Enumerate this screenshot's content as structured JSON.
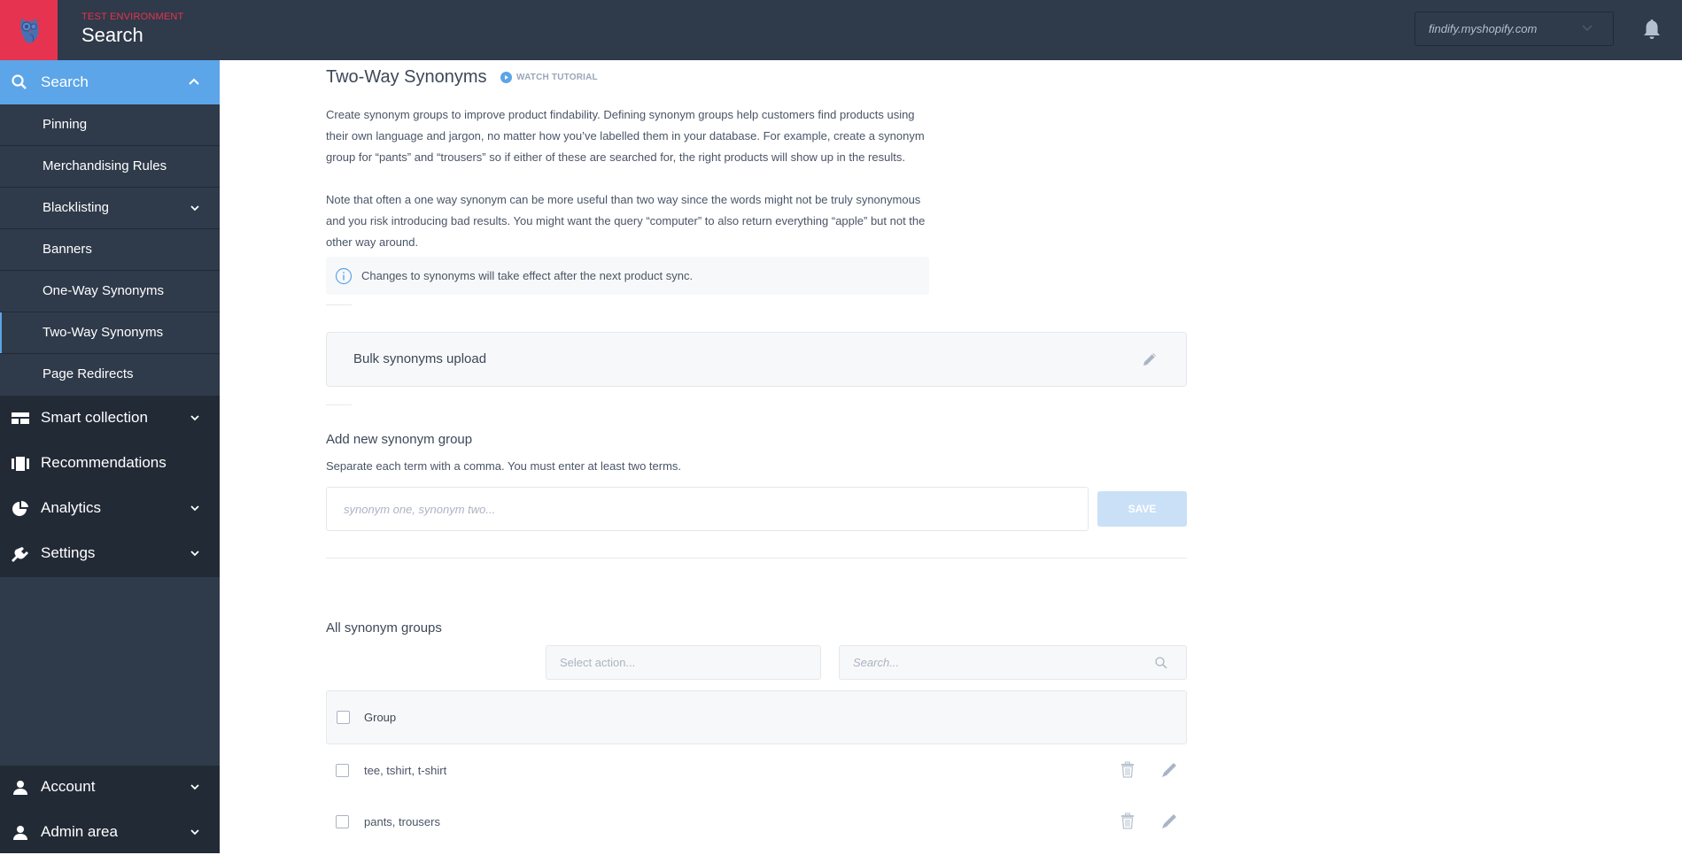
{
  "header": {
    "environment_label": "TEST ENVIRONMENT",
    "title": "Search",
    "shop_selector": {
      "value": "findify.myshopify.com"
    },
    "notifications_icon": "bell-icon"
  },
  "colors": {
    "brand_red": "#e63350",
    "accent_blue": "#5ba5e8",
    "header_bg": "#2f3a4a",
    "sidebar_dark": "#222a36"
  },
  "sidebar": {
    "search": {
      "label": "Search",
      "icon": "search-icon",
      "expanded": true
    },
    "sub_items": [
      {
        "label": "Pinning",
        "has_children": false,
        "active": false
      },
      {
        "label": "Merchandising Rules",
        "has_children": false,
        "active": false
      },
      {
        "label": "Blacklisting",
        "has_children": true,
        "active": false
      },
      {
        "label": "Banners",
        "has_children": false,
        "active": false
      },
      {
        "label": "One-Way Synonyms",
        "has_children": false,
        "active": false
      },
      {
        "label": "Two-Way Synonyms",
        "has_children": false,
        "active": true
      },
      {
        "label": "Page Redirects",
        "has_children": false,
        "active": false
      }
    ],
    "main_items": [
      {
        "label": "Smart collection",
        "icon": "layout-icon",
        "has_children": true
      },
      {
        "label": "Recommendations",
        "icon": "carousel-icon",
        "has_children": false
      },
      {
        "label": "Analytics",
        "icon": "pie-chart-icon",
        "has_children": true
      },
      {
        "label": "Settings",
        "icon": "plug-icon",
        "has_children": true
      }
    ],
    "bottom_items": [
      {
        "label": "Account",
        "icon": "user-icon",
        "has_children": true
      },
      {
        "label": "Admin area",
        "icon": "user-icon",
        "has_children": true
      }
    ]
  },
  "main": {
    "title": "Two-Way Synonyms",
    "watch_tutorial": "WATCH TUTORIAL",
    "description_1": "Create synonym groups to improve product findability. Defining synonym groups help customers find products using their own language and jargon, no matter how you’ve labelled them in your database. For example, create a synonym group for “pants” and “trousers” so if either of these are searched for, the right products will show up in the results.",
    "description_2": "Note that often a one way synonym can be more useful than two way since the words might not be truly synonymous and you risk introducing bad results. You might want the query “computer” to also return everything “apple” but not the other way around.",
    "info_notice": "Changes to synonyms will take effect after the next product sync.",
    "bulk_upload": {
      "label": "Bulk synonyms upload"
    },
    "add_group": {
      "title": "Add new synonym group",
      "hint": "Separate each term with a comma. You must enter at least two terms.",
      "input_value": "",
      "input_placeholder": "synonym one, synonym two...",
      "save_label": "SAVE",
      "save_enabled": false
    },
    "groups": {
      "title": "All synonym groups",
      "select_action_placeholder": "Select action...",
      "search_placeholder": "Search...",
      "column_header": "Group",
      "rows": [
        {
          "terms": "tee, tshirt, t-shirt",
          "checked": false
        },
        {
          "terms": "pants, trousers",
          "checked": false
        }
      ]
    }
  }
}
